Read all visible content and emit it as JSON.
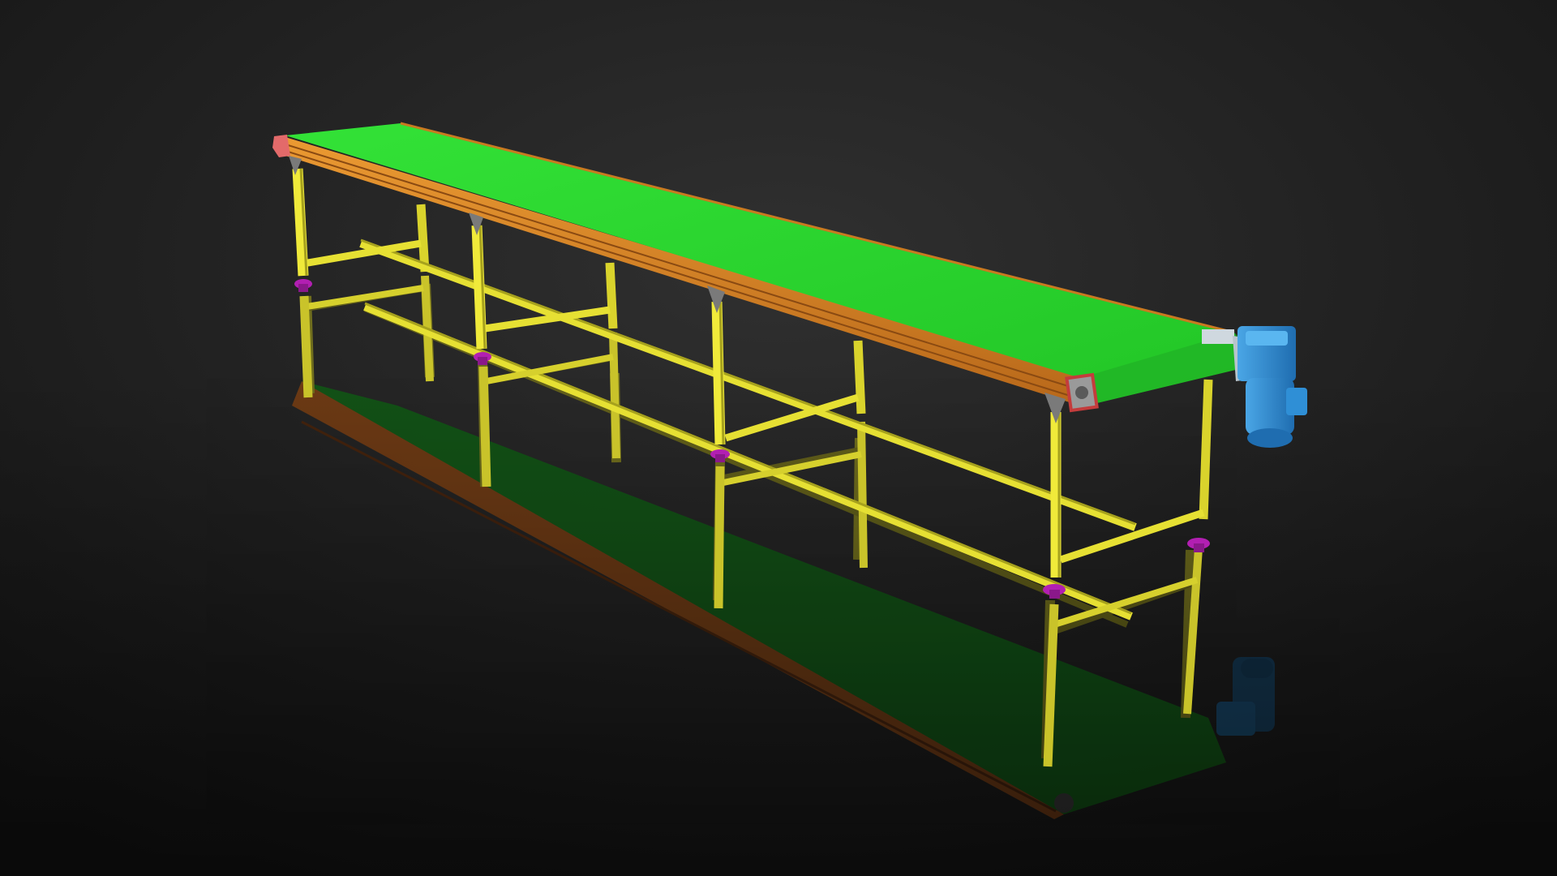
{
  "scene": {
    "subject": "belt-conveyor-cad-render",
    "colors": {
      "background_top": "#2d2d2d",
      "background_bottom": "#111111",
      "belt": "#2ad32e",
      "belt_edge": "#1a9a1f",
      "side_rail": "#e08a24",
      "side_rail_dark": "#9c5414",
      "frame": "#e6e033",
      "frame_dark": "#a6a11d",
      "leveling_foot": "#b21fb2",
      "bracket": "#7a7a7a",
      "motor": "#2f8fd6",
      "motor_dark": "#1e6aa8",
      "end_cap": "#e36a6a",
      "reflection_belt": "#1a4a16",
      "reflection_rail": "#6a3a10"
    },
    "icons": {
      "motor": "gear-motor-icon",
      "foot": "leveling-foot-icon",
      "bracket": "corner-bracket-icon"
    }
  }
}
